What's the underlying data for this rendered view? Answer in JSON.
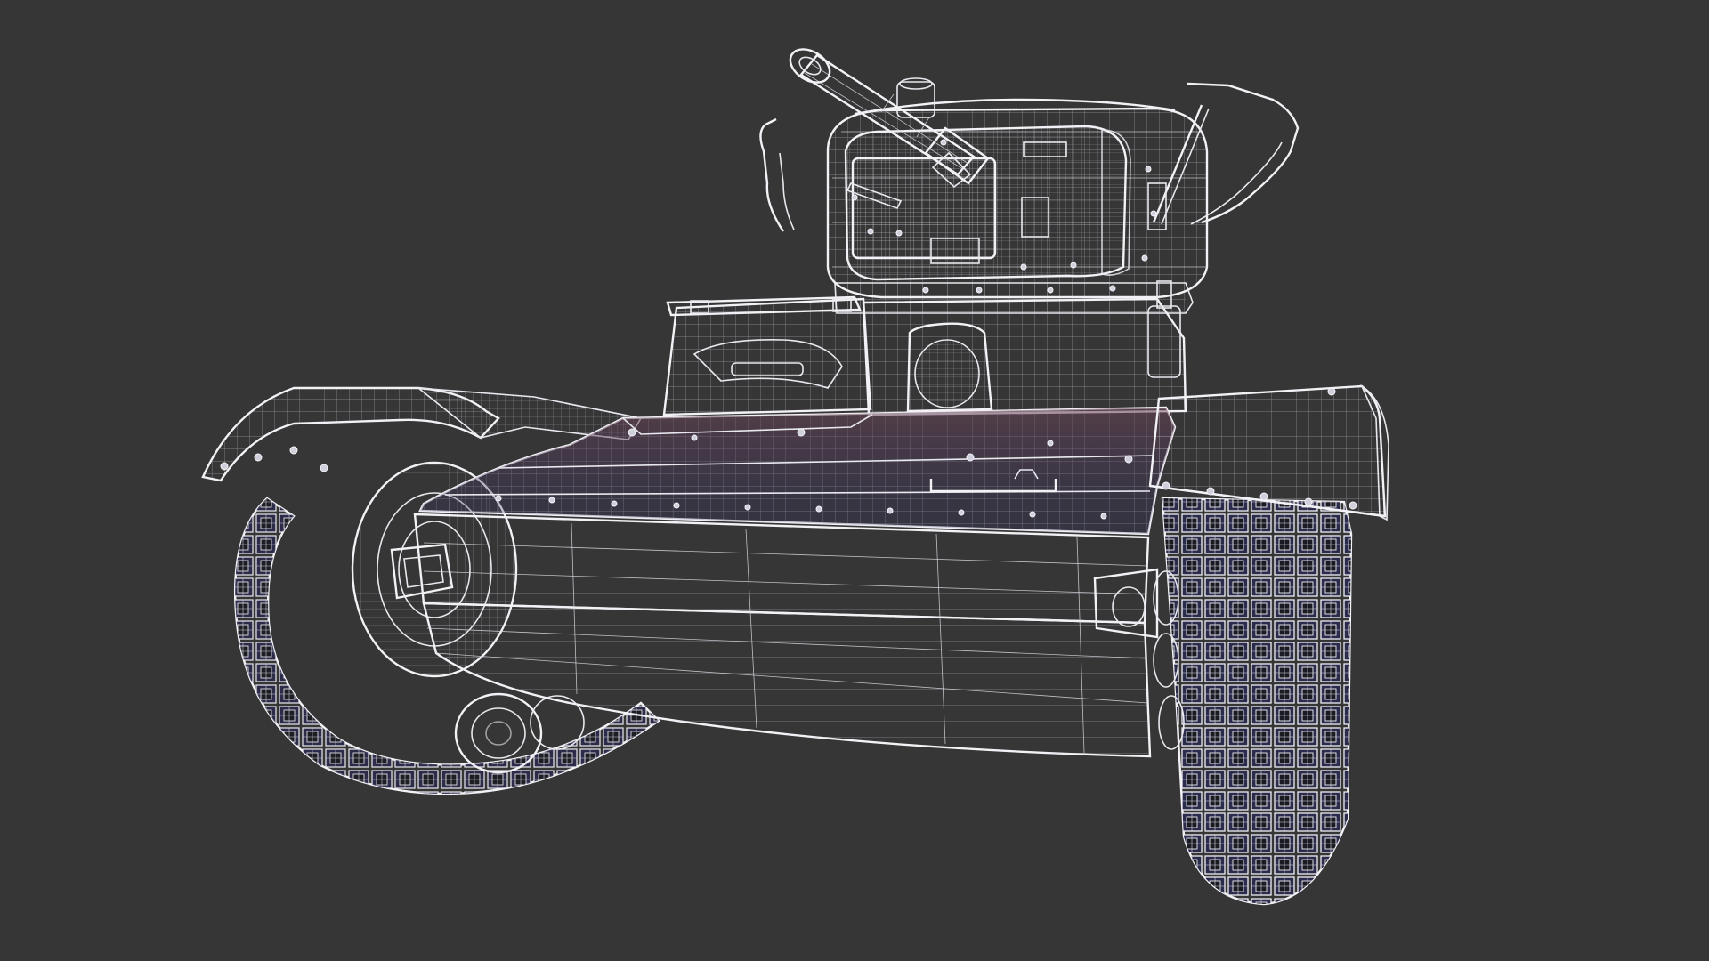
{
  "scene": {
    "subject_icon": "tank-wireframe-icon",
    "colors": {
      "background": "#363636",
      "wire": "#e8e8ee",
      "armor_blue": "#2c2f73",
      "armor_violet": "#53365f",
      "armor_orange": "#a85a3c",
      "hull_dark": "#121215"
    }
  }
}
